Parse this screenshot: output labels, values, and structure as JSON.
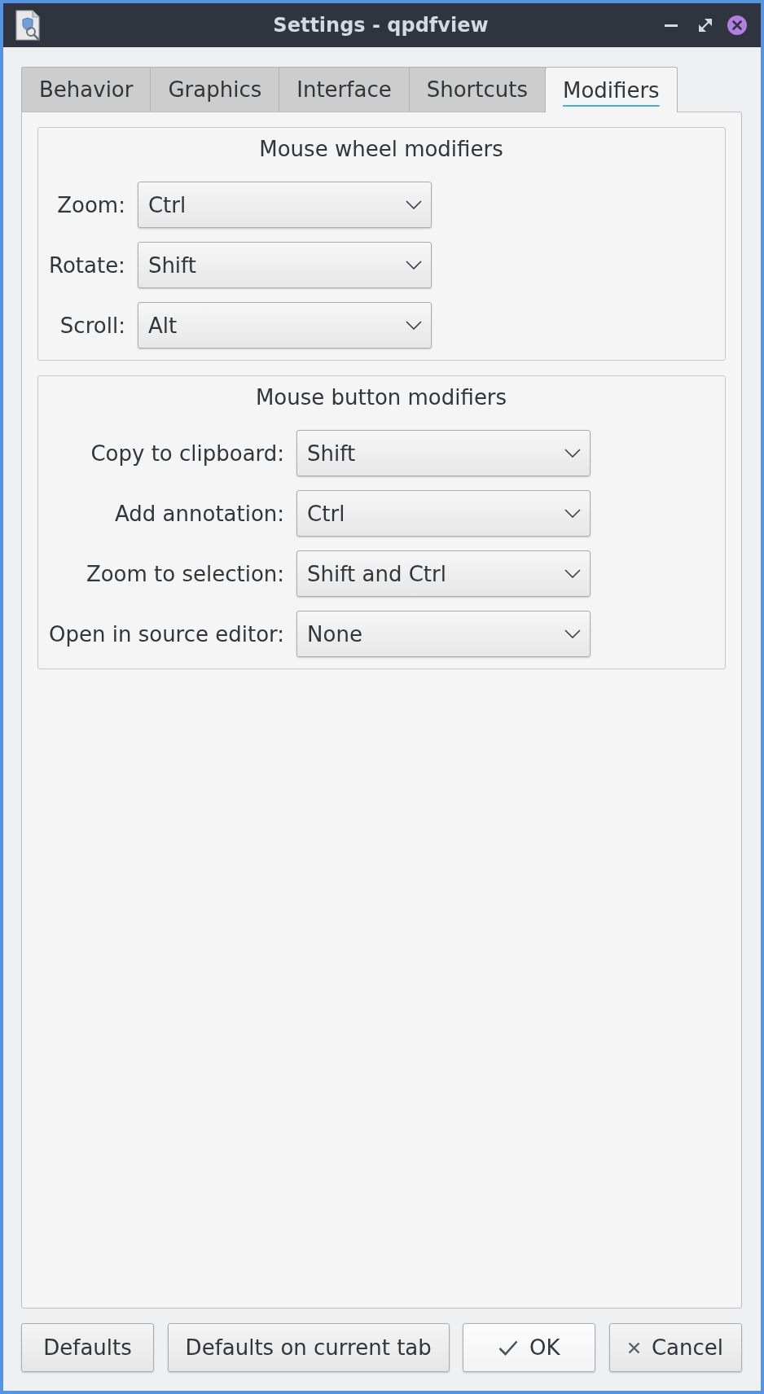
{
  "window": {
    "title": "Settings - qpdfview"
  },
  "tabs": [
    {
      "label": "Behavior",
      "selected": false
    },
    {
      "label": "Graphics",
      "selected": false
    },
    {
      "label": "Interface",
      "selected": false
    },
    {
      "label": "Shortcuts",
      "selected": false
    },
    {
      "label": "Modifiers",
      "selected": true
    }
  ],
  "groups": [
    {
      "title": "Mouse wheel modifiers",
      "rows": [
        {
          "label": "Zoom:",
          "value": "Ctrl"
        },
        {
          "label": "Rotate:",
          "value": "Shift"
        },
        {
          "label": "Scroll:",
          "value": "Alt"
        }
      ]
    },
    {
      "title": "Mouse button modifiers",
      "rows": [
        {
          "label": "Copy to clipboard:",
          "value": "Shift"
        },
        {
          "label": "Add annotation:",
          "value": "Ctrl"
        },
        {
          "label": "Zoom to selection:",
          "value": "Shift and Ctrl"
        },
        {
          "label": "Open in source editor:",
          "value": "None"
        }
      ]
    }
  ],
  "buttons": [
    {
      "label": "Defaults",
      "kind": "reset"
    },
    {
      "label": "Defaults on current tab",
      "kind": "reset"
    },
    {
      "label": "OK",
      "kind": "accept"
    },
    {
      "label": "Cancel",
      "kind": "reject"
    }
  ]
}
